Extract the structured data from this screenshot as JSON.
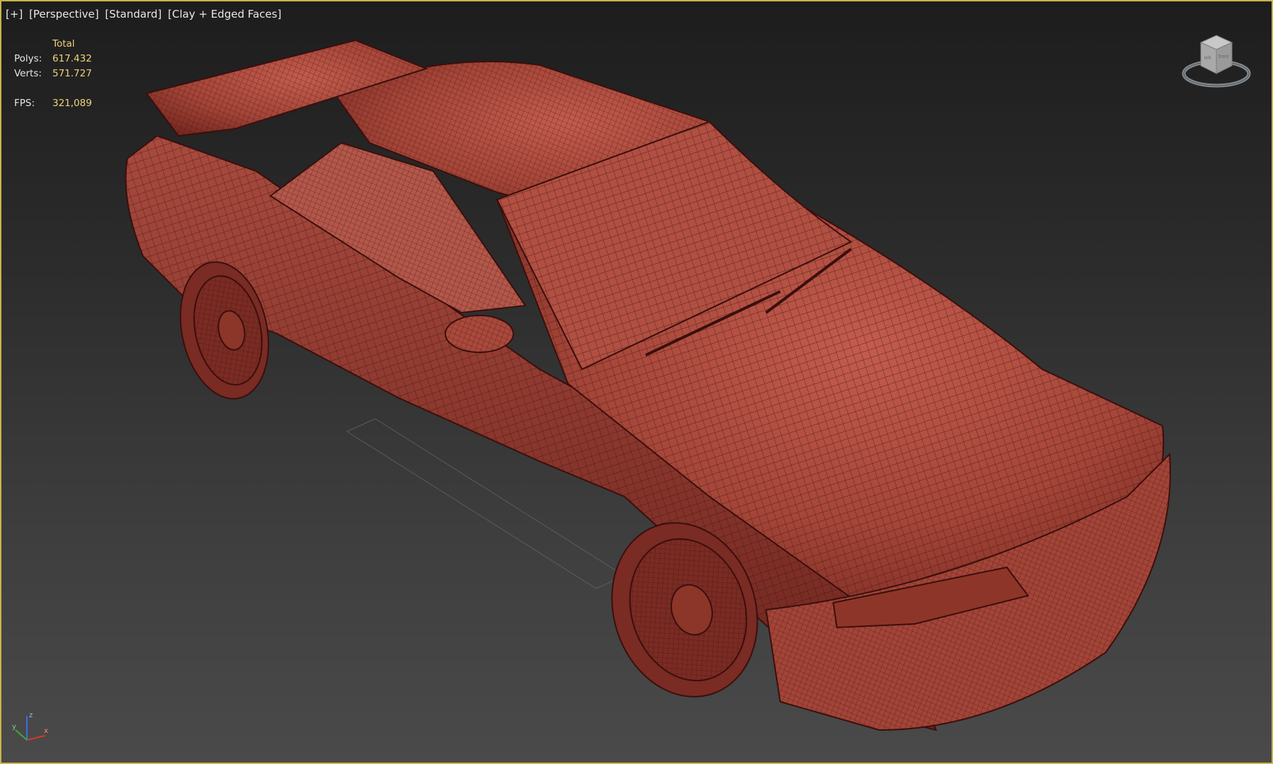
{
  "viewport": {
    "labels": [
      "[+]",
      "[Perspective]",
      "[Standard]",
      "[Clay + Edged Faces]"
    ]
  },
  "stats": {
    "header": "Total",
    "polys_label": "Polys:",
    "polys_value": "617.432",
    "verts_label": "Verts:",
    "verts_value": "571.727",
    "fps_label": "FPS:",
    "fps_value": "321,089"
  },
  "viewcube": {
    "face_left": "left",
    "face_front": "front"
  },
  "axis": {
    "z": "z",
    "x": "x",
    "y": "y"
  },
  "colors": {
    "viewport_border": "#c9b34a",
    "clay": "#a84a3e",
    "clay_dark": "#6e2620",
    "wire": "#3a0f0c",
    "stat_value": "#f0d27a"
  },
  "icons": {
    "viewcube": "viewcube-icon",
    "axis": "axis-tripod-icon"
  }
}
